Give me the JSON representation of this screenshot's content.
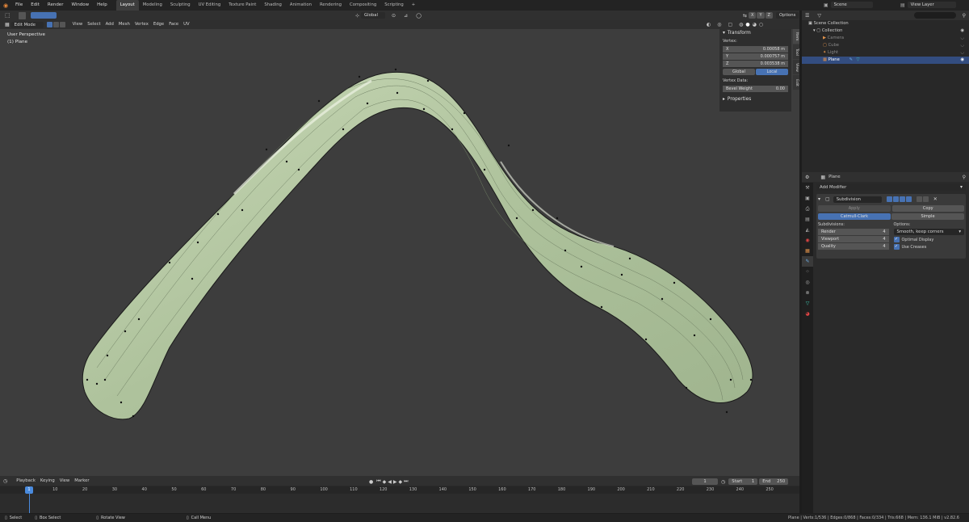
{
  "topbar": {
    "menus": [
      "File",
      "Edit",
      "Render",
      "Window",
      "Help"
    ],
    "workspaces": [
      "Layout",
      "Modeling",
      "Sculpting",
      "UV Editing",
      "Texture Paint",
      "Shading",
      "Animation",
      "Rendering",
      "Compositing",
      "Scripting"
    ],
    "active_workspace": "Layout",
    "add_tab": "+",
    "scene_label": "Scene",
    "view_layer_label": "View Layer"
  },
  "viewport_header": {
    "transform_orientation": "Global",
    "options_label": "Options",
    "mode": "Edit Mode",
    "menus": [
      "View",
      "Select",
      "Add",
      "Mesh",
      "Vertex",
      "Edge",
      "Face",
      "UV"
    ],
    "axes": [
      "X",
      "Y",
      "Z"
    ]
  },
  "viewport": {
    "perspective_label": "User Perspective",
    "object_label": "(1) Plane"
  },
  "npanel": {
    "tabs": [
      "Item",
      "Tool",
      "View",
      "Edit"
    ],
    "transform_title": "Transform",
    "vertex_label": "Vertex:",
    "x_label": "X",
    "x_value": "0.00058 m",
    "y_label": "Y",
    "y_value": "0.000757 m",
    "z_label": "Z",
    "z_value": "0.003538 m",
    "global_label": "Global",
    "local_label": "Local",
    "vertex_data_label": "Vertex Data:",
    "bevel_weight_label": "Bevel Weight",
    "bevel_weight_value": "0.00",
    "properties_title": "Properties"
  },
  "outliner": {
    "root": "Scene Collection",
    "items": [
      {
        "name": "Collection",
        "level": 1
      },
      {
        "name": "Camera",
        "level": 2
      },
      {
        "name": "Cube",
        "level": 2
      },
      {
        "name": "Light",
        "level": 2
      },
      {
        "name": "Plane",
        "level": 2
      }
    ]
  },
  "properties": {
    "object_name": "Plane",
    "add_modifier": "Add Modifier",
    "modifier_name": "Subdivision",
    "apply_label": "Apply",
    "copy_label": "Copy",
    "catmull_label": "Catmull-Clark",
    "simple_label": "Simple",
    "subdivisions_label": "Subdivisions:",
    "options_label": "Options:",
    "render_label": "Render",
    "render_value": "4",
    "viewport_label": "Viewport",
    "viewport_value": "4",
    "quality_label": "Quality",
    "quality_value": "4",
    "uv_smooth": "Smooth, keep corners",
    "optimal_display": "Optimal Display",
    "use_creases": "Use Creases"
  },
  "timeline": {
    "menus": [
      "Playback",
      "Keying",
      "View",
      "Marker"
    ],
    "current_frame": "1",
    "start_label": "Start",
    "start_value": "1",
    "end_label": "End",
    "end_value": "250",
    "ruler": [
      "1",
      "10",
      "20",
      "30",
      "40",
      "50",
      "60",
      "70",
      "80",
      "90",
      "100",
      "110",
      "120",
      "130",
      "140",
      "150",
      "160",
      "170",
      "180",
      "190",
      "200",
      "210",
      "220",
      "230",
      "240",
      "250"
    ]
  },
  "statusbar": {
    "select": "Select",
    "box_select": "Box Select",
    "rotate_view": "Rotate View",
    "call_menu": "Call Menu",
    "stats": "Plane | Verts:1/536 | Edges:0/868 | Faces:0/334 | Tris:668 | Mem: 136.1 MiB | v2.82.6"
  },
  "colors": {
    "accent": "#4772b3",
    "timeline_playhead": "#4a8bde",
    "mesh": "#b5c7a6"
  }
}
